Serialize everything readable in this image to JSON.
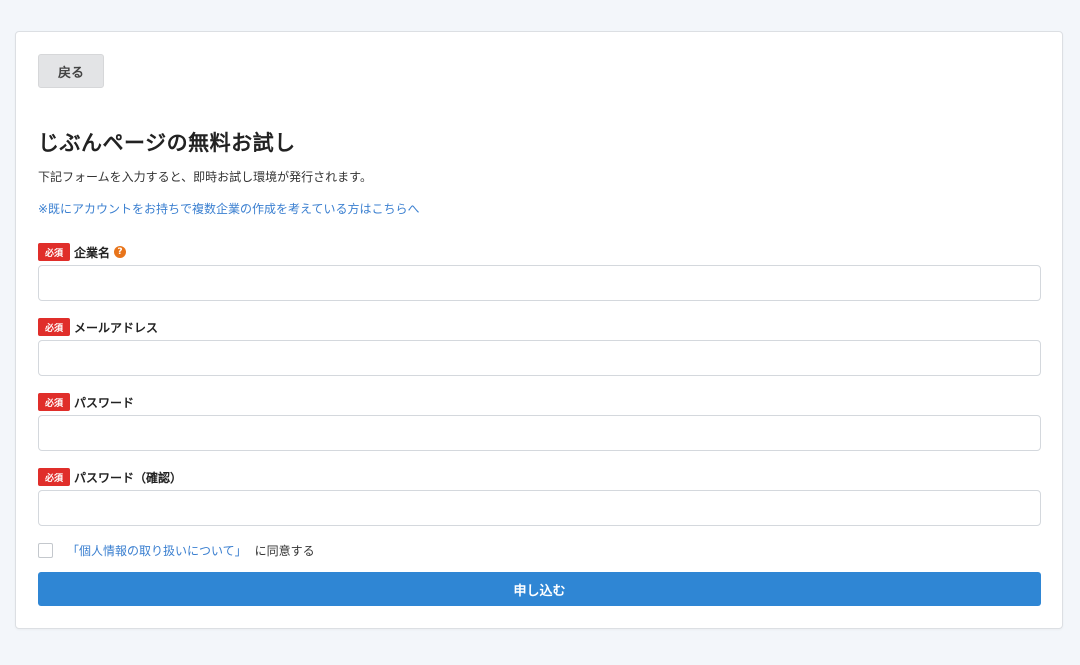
{
  "back_button": {
    "label": "戻る"
  },
  "title": "じぶんページの無料お試し",
  "description": "下記フォームを入力すると、即時お試し環境が発行されます。",
  "note_link": "※既にアカウントをお持ちで複数企業の作成を考えている方はこちらへ",
  "required_badge": "必須",
  "fields": [
    {
      "label": "企業名",
      "value": "",
      "placeholder": ""
    },
    {
      "label": "メールアドレス",
      "value": "",
      "placeholder": ""
    },
    {
      "label": "パスワード",
      "value": "",
      "placeholder": ""
    },
    {
      "label": "パスワード（確認）",
      "value": "",
      "placeholder": ""
    }
  ],
  "help_icon": {
    "glyph": "?"
  },
  "agreement": {
    "checked": false,
    "link_text": "「個人情報の取り扱いについて」",
    "suffix_text": "に同意する"
  },
  "submit_button": {
    "label": "申し込む"
  },
  "colors": {
    "required_badge": "#e02e2a",
    "link": "#3a7fd0",
    "primary_button": "#2f86d4",
    "help_icon": "#e8741a"
  }
}
